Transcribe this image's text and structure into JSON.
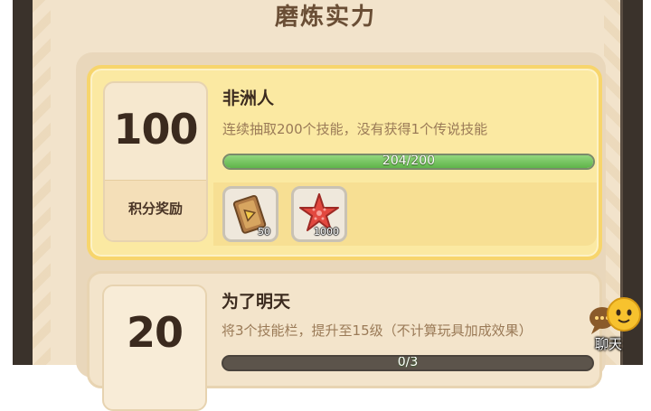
{
  "header": {
    "title": "磨炼实力"
  },
  "tasks": [
    {
      "points": "100",
      "points_label": "积分奖励",
      "title": "非洲人",
      "description": "连续抽取200个技能，没有获得1个传说技能",
      "progress_text": "204/200",
      "progress": {
        "current": 204,
        "total": 200
      },
      "rewards": [
        {
          "icon": "ticket-play-icon",
          "count": "50"
        },
        {
          "icon": "starfish-icon",
          "count": "1000"
        }
      ]
    },
    {
      "points": "20",
      "title": "为了明天",
      "description": "将3个技能栏，提升至15级（不计算玩具加成效果）",
      "progress_text": "0/3",
      "progress": {
        "current": 0,
        "total": 3
      }
    }
  ],
  "chat": {
    "label": "聊天",
    "icon": "chat-bubble-icon"
  },
  "colors": {
    "accent_gold": "#f7d56c",
    "progress_green": "#6cc257",
    "title_brown": "#6a4e35"
  }
}
